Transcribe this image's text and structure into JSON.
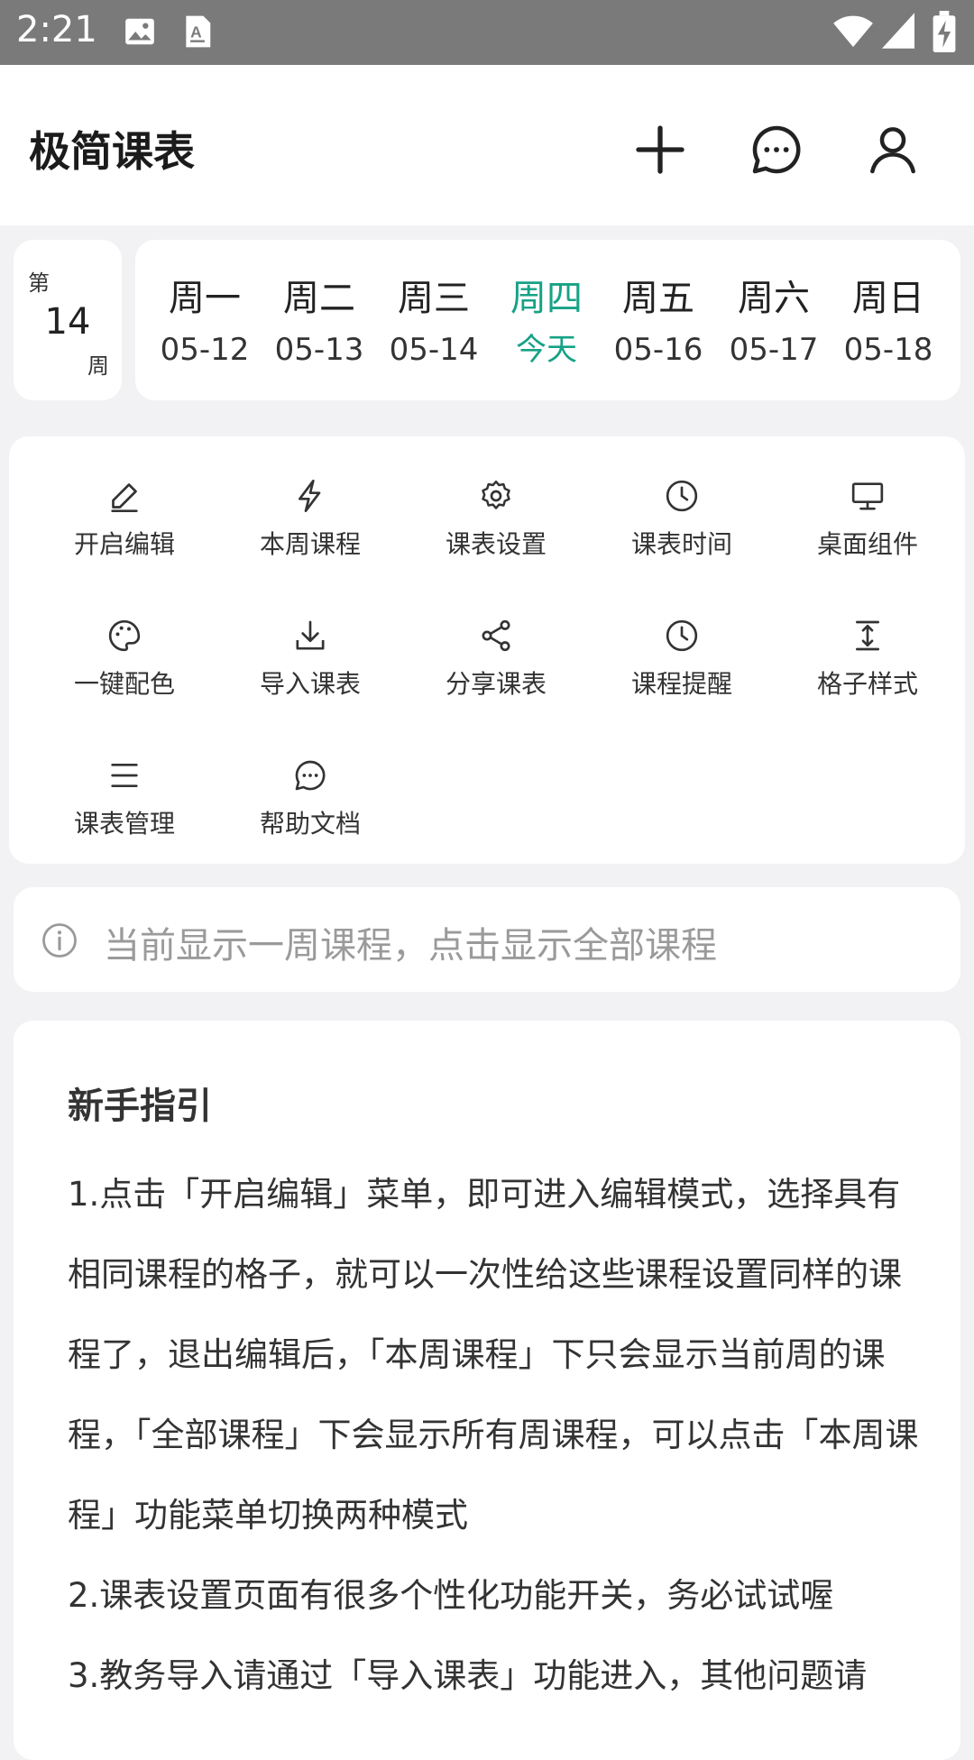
{
  "status_bar": {
    "time": "2:21",
    "icons": [
      "image-icon",
      "text-a-icon",
      "wifi-icon",
      "signal-icon",
      "battery-charging-icon"
    ]
  },
  "app_bar": {
    "title": "极简课表",
    "actions": [
      "add-icon",
      "message-icon",
      "profile-icon"
    ]
  },
  "week": {
    "prefix": "第",
    "number": "14",
    "suffix": "周"
  },
  "days": [
    {
      "name": "周一",
      "date": "05-12",
      "today": false
    },
    {
      "name": "周二",
      "date": "05-13",
      "today": false
    },
    {
      "name": "周三",
      "date": "05-14",
      "today": false
    },
    {
      "name": "周四",
      "date": "今天",
      "today": true
    },
    {
      "name": "周五",
      "date": "05-16",
      "today": false
    },
    {
      "name": "周六",
      "date": "05-17",
      "today": false
    },
    {
      "name": "周日",
      "date": "05-18",
      "today": false
    }
  ],
  "menu": [
    {
      "label": "开启编辑",
      "icon": "pencil-icon"
    },
    {
      "label": "本周课程",
      "icon": "lightning-icon"
    },
    {
      "label": "课表设置",
      "icon": "gear-icon"
    },
    {
      "label": "课表时间",
      "icon": "clock-icon"
    },
    {
      "label": "桌面组件",
      "icon": "monitor-icon"
    },
    {
      "label": "一键配色",
      "icon": "palette-icon"
    },
    {
      "label": "导入课表",
      "icon": "download-icon"
    },
    {
      "label": "分享课表",
      "icon": "share-icon"
    },
    {
      "label": "课程提醒",
      "icon": "clock-icon"
    },
    {
      "label": "格子样式",
      "icon": "height-icon"
    },
    {
      "label": "课表管理",
      "icon": "list-icon"
    },
    {
      "label": "帮助文档",
      "icon": "chat-icon"
    }
  ],
  "info": {
    "text": "当前显示一周课程，点击显示全部课程",
    "icon": "info-icon"
  },
  "guide": {
    "title": "新手指引",
    "paragraphs": [
      "1.点击「开启编辑」菜单，即可进入编辑模式，选择具有相同课程的格子，就可以一次性给这些课程设置同样的课程了，退出编辑后，「本周课程」下只会显示当前周的课程，「全部课程」下会显示所有周课程，可以点击「本周课程」功能菜单切换两种模式",
      "2.课表设置页面有很多个性化功能开关，务必试试喔",
      "3.教务导入请通过「导入课表」功能进入，其他问题请"
    ]
  },
  "colors": {
    "accent": "#17a286",
    "status_bar": "#7a7a7a",
    "background": "#f2f2f4"
  }
}
